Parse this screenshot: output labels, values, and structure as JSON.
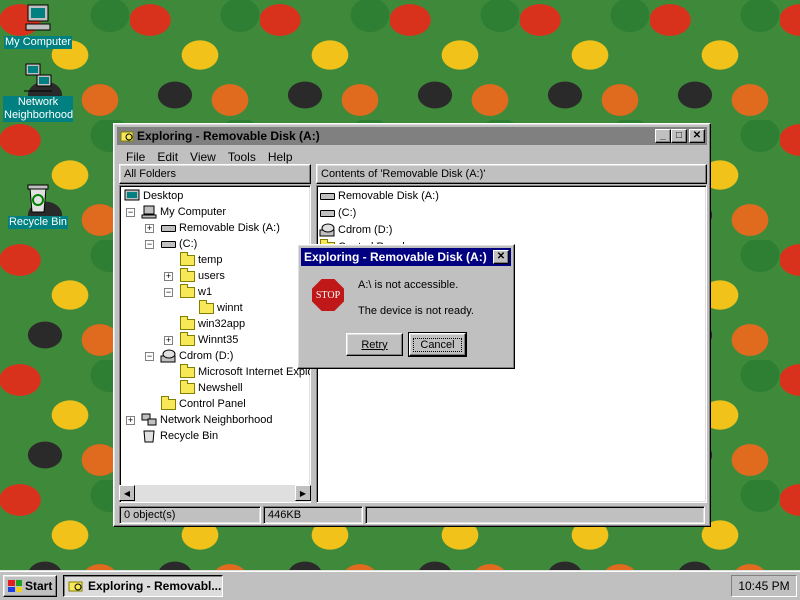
{
  "desktop": {
    "icons": [
      {
        "label": "My Computer",
        "icon": "computer-icon"
      },
      {
        "label": "Network Neighborhood",
        "icon": "network-icon"
      },
      {
        "label": "Recycle Bin",
        "icon": "recycle-bin-icon"
      }
    ]
  },
  "explorer": {
    "title": "Exploring - Removable Disk (A:)",
    "menu": [
      "File",
      "Edit",
      "View",
      "Tools",
      "Help"
    ],
    "left_header": "All Folders",
    "right_header": "Contents of 'Removable Disk (A:)'",
    "tree": [
      {
        "label": "Desktop",
        "icon": "desktop-icon"
      },
      {
        "label": "My Computer",
        "icon": "computer-icon"
      },
      {
        "label": "Removable Disk (A:)",
        "icon": "floppy-drive-icon"
      },
      {
        "label": "(C:)",
        "icon": "hard-drive-icon"
      },
      {
        "label": "temp",
        "icon": "folder-icon"
      },
      {
        "label": "users",
        "icon": "folder-icon"
      },
      {
        "label": "w1",
        "icon": "folder-icon"
      },
      {
        "label": "winnt",
        "icon": "folder-icon"
      },
      {
        "label": "win32app",
        "icon": "folder-icon"
      },
      {
        "label": "Winnt35",
        "icon": "folder-icon"
      },
      {
        "label": "Cdrom (D:)",
        "icon": "cdrom-icon"
      },
      {
        "label": "Microsoft Internet Explo",
        "icon": "folder-icon"
      },
      {
        "label": "Newshell",
        "icon": "folder-icon"
      },
      {
        "label": "Control Panel",
        "icon": "control-panel-icon"
      },
      {
        "label": "Network Neighborhood",
        "icon": "network-icon"
      },
      {
        "label": "Recycle Bin",
        "icon": "recycle-bin-icon"
      }
    ],
    "contents": [
      {
        "label": "Removable Disk (A:)",
        "icon": "floppy-drive-icon"
      },
      {
        "label": "(C:)",
        "icon": "hard-drive-icon"
      },
      {
        "label": "Cdrom (D:)",
        "icon": "cdrom-icon"
      },
      {
        "label": "Control Panel",
        "icon": "control-panel-icon"
      }
    ],
    "status": {
      "objects": "0 object(s)",
      "size": "446KB"
    }
  },
  "dialog": {
    "title": "Exploring - Removable Disk (A:)",
    "stop_text": "STOP",
    "message": "A:\\ is not accessible.",
    "detail": "The device is not ready.",
    "retry_label": "Retry",
    "cancel_label": "Cancel"
  },
  "taskbar": {
    "start_label": "Start",
    "task_label": "Exploring - Removabl...",
    "clock": "10:45 PM"
  },
  "colors": {
    "desktop": "#008080",
    "dialog_title": "#000080",
    "inactive_title": "#808080",
    "face": "#c0c0c0",
    "stop": "#c01818"
  }
}
